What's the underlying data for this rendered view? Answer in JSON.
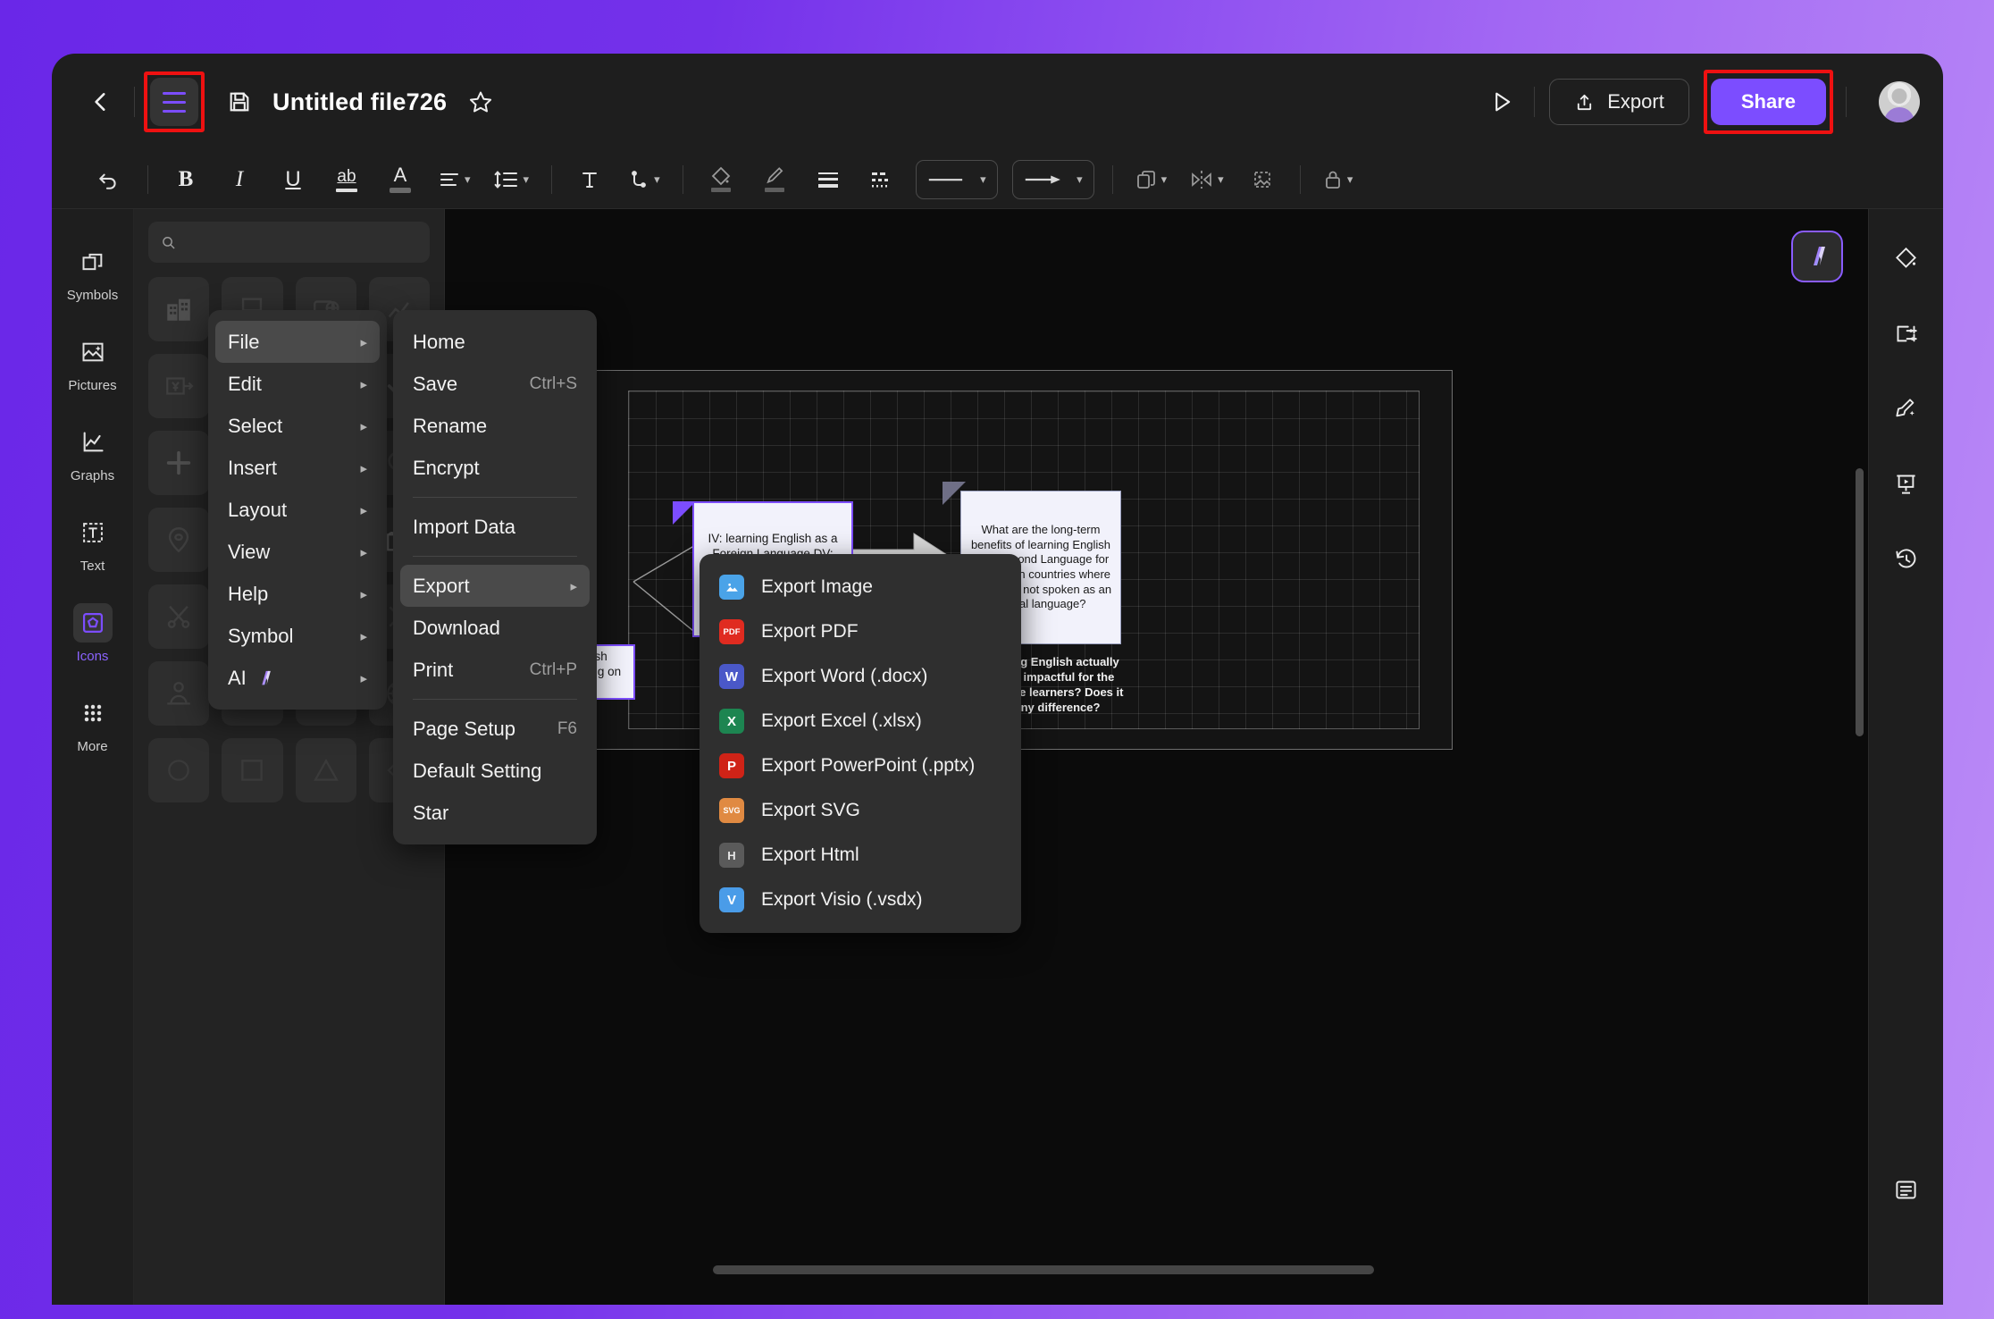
{
  "header": {
    "back_icon": "chevron-left-icon",
    "menu_icon": "hamburger-menu-icon",
    "save_icon": "save-disk-icon",
    "title": "Untitled file726",
    "star_icon": "star-outline-icon",
    "present_icon": "play-present-icon",
    "export_label": "Export",
    "share_label": "Share",
    "avatar_icon": "user-avatar"
  },
  "toolbar": {
    "items": [
      {
        "name": "bold-button",
        "glyph": "B"
      },
      {
        "name": "italic-button",
        "glyph": "I"
      },
      {
        "name": "underline-button",
        "glyph": "U"
      },
      {
        "name": "strikethrough-button",
        "glyph": "ab"
      },
      {
        "name": "font-color-button",
        "glyph": "A"
      },
      {
        "name": "text-align-button",
        "glyph": "align"
      },
      {
        "name": "line-spacing-button",
        "glyph": "spacing"
      },
      {
        "name": "text-box-button",
        "glyph": "T"
      },
      {
        "name": "connector-style-button",
        "glyph": "connector"
      },
      {
        "name": "fill-color-button",
        "glyph": "fill"
      },
      {
        "name": "line-color-button",
        "glyph": "brush"
      },
      {
        "name": "line-weight-button",
        "glyph": "weight"
      },
      {
        "name": "line-dash-button",
        "glyph": "dash"
      },
      {
        "name": "line-style-select",
        "glyph": "line"
      },
      {
        "name": "arrow-style-select",
        "glyph": "arrow"
      },
      {
        "name": "arrange-button",
        "glyph": "layers"
      },
      {
        "name": "flip-button",
        "glyph": "flip"
      },
      {
        "name": "crop-button",
        "glyph": "crop"
      },
      {
        "name": "lock-button",
        "glyph": "lock"
      }
    ]
  },
  "left_rail": {
    "items": [
      {
        "label": "Symbols",
        "icon": "symbols-icon",
        "active": false
      },
      {
        "label": "Pictures",
        "icon": "pictures-icon",
        "active": false
      },
      {
        "label": "Graphs",
        "icon": "graphs-icon",
        "active": false
      },
      {
        "label": "Text",
        "icon": "text-icon",
        "active": false
      },
      {
        "label": "Icons",
        "icon": "icons-icon",
        "active": true
      },
      {
        "label": "More",
        "icon": "more-grid-icon",
        "active": false
      }
    ]
  },
  "icons_panel": {
    "search_placeholder": "",
    "search_value": "",
    "cells": [
      "building-icon",
      "easel-icon",
      "card-globe-icon",
      "graph-up-icon",
      "yen-transfer-icon",
      "home-icon",
      "penguin-icon",
      "check-icon",
      "plus-icon",
      "refresh-icon",
      "qr-code-icon",
      "search-magnifier-icon",
      "location-pin-icon",
      "chevron-right-icon",
      "question-circle-icon",
      "shop-icon",
      "scissors-icon",
      "eye-scan-icon",
      "compass-icon",
      "close-x-icon",
      "person-speaker-icon",
      "tower-icon",
      "disc-icon",
      "wheel-icon",
      "circle-icon",
      "square-icon",
      "triangle-icon",
      "diamond-icon"
    ]
  },
  "right_rail": {
    "items": [
      {
        "icon": "fill-bucket-icon"
      },
      {
        "icon": "page-settings-icon"
      },
      {
        "icon": "theme-brush-icon"
      },
      {
        "icon": "slideshow-icon"
      },
      {
        "icon": "history-clock-icon"
      }
    ],
    "bottom_icon": "outline-panel-icon"
  },
  "menu_main": {
    "items": [
      {
        "label": "File",
        "arrow": "▸",
        "active": true,
        "badge": null
      },
      {
        "label": "Edit",
        "arrow": "▸",
        "active": false,
        "badge": null
      },
      {
        "label": "Select",
        "arrow": "▸",
        "active": false,
        "badge": null
      },
      {
        "label": "Insert",
        "arrow": "▸",
        "active": false,
        "badge": null
      },
      {
        "label": "Layout",
        "arrow": "▸",
        "active": false,
        "badge": null
      },
      {
        "label": "View",
        "arrow": "▸",
        "active": false,
        "badge": null
      },
      {
        "label": "Help",
        "arrow": "▸",
        "active": false,
        "badge": null
      },
      {
        "label": "Symbol",
        "arrow": "▸",
        "active": false,
        "badge": null
      },
      {
        "label": "AI",
        "arrow": "▸",
        "active": false,
        "badge": "ai-sparkle-icon"
      }
    ]
  },
  "menu_file": {
    "items": [
      {
        "label": "Home",
        "shortcut": "",
        "arrow": "",
        "active": false,
        "sep_after": false
      },
      {
        "label": "Save",
        "shortcut": "Ctrl+S",
        "arrow": "",
        "active": false,
        "sep_after": false
      },
      {
        "label": "Rename",
        "shortcut": "",
        "arrow": "",
        "active": false,
        "sep_after": false
      },
      {
        "label": "Encrypt",
        "shortcut": "",
        "arrow": "",
        "active": false,
        "sep_after": true
      },
      {
        "label": "Import Data",
        "shortcut": "",
        "arrow": "",
        "active": false,
        "sep_after": true
      },
      {
        "label": "Export",
        "shortcut": "",
        "arrow": "▸",
        "active": true,
        "sep_after": false
      },
      {
        "label": "Download",
        "shortcut": "",
        "arrow": "",
        "active": false,
        "sep_after": false
      },
      {
        "label": "Print",
        "shortcut": "Ctrl+P",
        "arrow": "",
        "active": false,
        "sep_after": true
      },
      {
        "label": "Page Setup",
        "shortcut": "F6",
        "arrow": "",
        "active": false,
        "sep_after": false
      },
      {
        "label": "Default Setting",
        "shortcut": "",
        "arrow": "",
        "active": false,
        "sep_after": false
      },
      {
        "label": "Star",
        "shortcut": "",
        "arrow": "",
        "active": false,
        "sep_after": false
      }
    ]
  },
  "menu_export": {
    "items": [
      {
        "label": "Export Image",
        "icon": "image-icon",
        "glyph": "▲",
        "bg": "#4aa3e8",
        "fg": "#ffffff"
      },
      {
        "label": "Export PDF",
        "icon": "pdf-icon",
        "glyph": "PDF",
        "bg": "#e02b20",
        "fg": "#ffffff"
      },
      {
        "label": "Export Word (.docx)",
        "icon": "word-icon",
        "glyph": "W",
        "bg": "#4a58c8",
        "fg": "#ffffff"
      },
      {
        "label": "Export Excel (.xlsx)",
        "icon": "excel-icon",
        "glyph": "X",
        "bg": "#1d8551",
        "fg": "#ffffff"
      },
      {
        "label": "Export PowerPoint (.pptx)",
        "icon": "ppt-icon",
        "glyph": "P",
        "bg": "#cf2317",
        "fg": "#ffffff"
      },
      {
        "label": "Export SVG",
        "icon": "svg-icon",
        "glyph": "SVG",
        "bg": "#e08a42",
        "fg": "#ffffff"
      },
      {
        "label": "Export Html",
        "icon": "html-icon",
        "glyph": "H",
        "bg": "#5a5a5a",
        "fg": "#e8e8e8"
      },
      {
        "label": "Export Visio (.vsdx)",
        "icon": "visio-icon",
        "glyph": "V",
        "bg": "#4a9ce8",
        "fg": "#ffffff"
      }
    ]
  },
  "canvas": {
    "ai_fab_icon": "ai-assistant-icon",
    "notes": [
      {
        "id": "note-iv-dv",
        "text": "IV: learning English as a Foreign Language DV: potential benefits or disadvantages for the future of the learners",
        "selected": true,
        "flag": "purple"
      },
      {
        "id": "note-question",
        "text": "What are the long-term benefits of learning English as a Second Language for learners in countries where English is not spoken as an official language?",
        "selected": false,
        "flag": "grey"
      },
      {
        "id": "note-career",
        "text": "need for English fluency depending on career field",
        "selected": true,
        "flag": "purple"
      }
    ],
    "free_text": "Is acquiring English actually helpful or impactful for the future of the learners? Does it make any difference?"
  },
  "highlights": {
    "color": "#ee1111",
    "targets": [
      "hamburger-menu-button",
      "share-button"
    ]
  }
}
